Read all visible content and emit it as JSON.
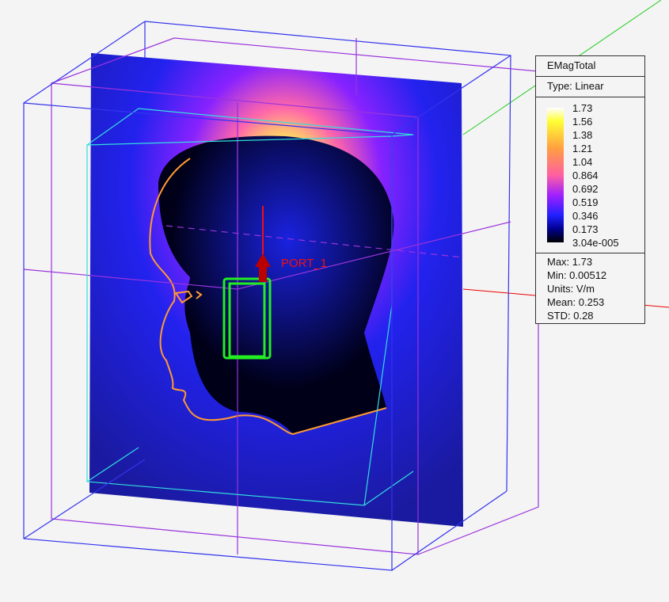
{
  "legend": {
    "title": "EMagTotal",
    "type": "Type: Linear",
    "ticks": [
      "1.73",
      "1.56",
      "1.38",
      "1.21",
      "1.04",
      "0.864",
      "0.692",
      "0.519",
      "0.346",
      "0.173",
      "3.04e-005"
    ],
    "stats": {
      "max": "Max: 1.73",
      "min": "Min: 0.00512",
      "units": "Units: V/m",
      "mean": "Mean: 0.253",
      "std": "STD: 0.28"
    }
  },
  "scene": {
    "port_label": "PORT_1",
    "colors": {
      "blue_box": "#3333ee",
      "purple_box": "#9933dd",
      "cyan_box": "#33dddd",
      "head_outline": "#ff9933",
      "phone": "#22ee22",
      "port_arrow": "#cc0000",
      "axis_x": "#ee0000",
      "axis_y": "#22cc22"
    }
  }
}
